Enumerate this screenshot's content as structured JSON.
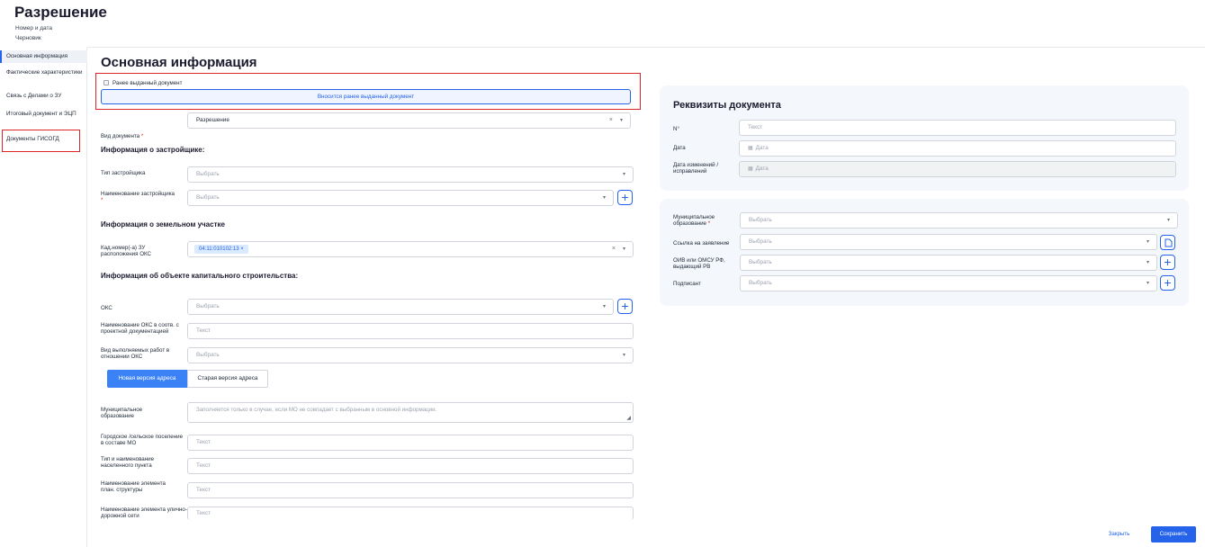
{
  "header": {
    "title": "Разрешение",
    "subtitle": "Номер и дата",
    "status": "Черновик"
  },
  "sidebar": {
    "items": [
      {
        "label": "Основная информация"
      },
      {
        "label": "Фактические характеристики"
      },
      {
        "label": "Связь с Делами о ЗУ"
      },
      {
        "label": "Итоговый документ и ЭЦП"
      },
      {
        "label": "Документы ГИСОГД"
      }
    ]
  },
  "main": {
    "section_title": "Основная информация",
    "previous_doc_checkbox": "Ранее выданный документ",
    "previous_doc_button": "Вносится ранее выданный документ",
    "doc_type": {
      "label": "Вид документа",
      "required": "*",
      "value": "Разрешение"
    },
    "developer": {
      "heading": "Информация о застройщике:",
      "type_label": "Тип застройщика",
      "type_value": "Выбрать",
      "name_label": "Наименование застройщика",
      "name_value": "Выбрать"
    },
    "land": {
      "heading": "Информация о земельном участке",
      "cad_label": "Кад.номер(-а) ЗУ расположения ОКС",
      "cad_chip": "04:11:010102:13"
    },
    "oks": {
      "heading": "Информация об объекте капитального строительства:",
      "oks_label": "ОКС",
      "oks_value": "Выбрать",
      "name_label": "Наименование ОКС в соотв. с проектной документацией",
      "name_value": "Текст",
      "works_label": "Вид выполняемых работ в отношении ОКС",
      "works_value": "Выбрать"
    },
    "address_tabs": {
      "new": "Новая версия адреса",
      "old": "Старая версия адреса"
    },
    "address": {
      "mun_label": "Муниципальное образование",
      "mun_placeholder": "Заполняется только в случае, если МО не совпадает с выбранным в основной информации.",
      "settlement_label": "Городское /сельское поселение в составе МО",
      "settlement_value": "Текст",
      "locality_label": "Тип и наименование населенного пункта",
      "locality_value": "Текст",
      "plan_label": "Наименование элемента план. структуры",
      "plan_value": "Текст",
      "street_label": "Наименование элемента улично-дорожной сети",
      "street_value": "Текст"
    }
  },
  "requisites": {
    "title": "Реквизиты документа",
    "number_label": "N°",
    "number_value": "Текст",
    "date_label": "Дата",
    "date_value": "Дата",
    "change_label": "Дата изменений / исправлений",
    "change_value": "Дата"
  },
  "extra": {
    "mun_label": "Муниципальное образование",
    "mun_required": "*",
    "mun_value": "Выбрать",
    "link_label": "Ссылка на заявление",
    "link_value": "Выбрать",
    "oiv_label": "ОИВ или ОМСУ РФ, выдающий РВ",
    "oiv_value": "Выбрать",
    "signer_label": "Подписант",
    "signer_value": "Выбрать"
  },
  "footer": {
    "close": "Закрыть",
    "save": "Сохранить"
  },
  "colors": {
    "accent": "#2563eb",
    "highlight": "#dc2626",
    "card_bg": "#f4f7fb"
  }
}
